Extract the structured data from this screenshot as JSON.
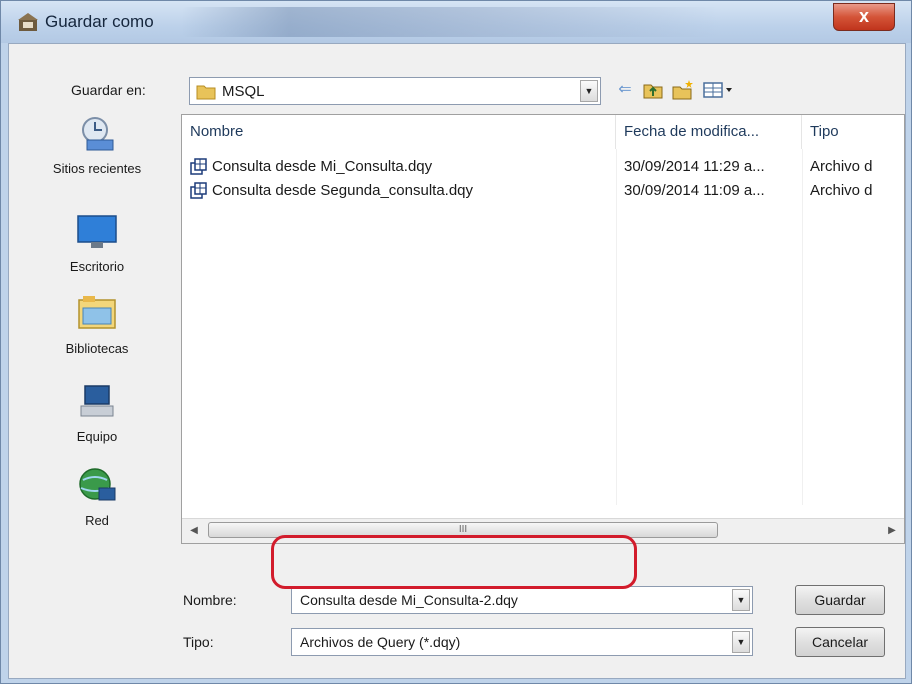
{
  "window": {
    "title": "Guardar como",
    "close_label": "x"
  },
  "toolbar": {
    "save_in_label": "Guardar en:",
    "current_folder": "MSQL",
    "back_icon": "back-arrow-icon",
    "up_icon": "up-folder-icon",
    "new_folder_icon": "new-folder-icon",
    "view_menu_icon": "view-menu-icon"
  },
  "places": [
    {
      "label": "Sitios recientes",
      "icon": "recent-places-icon"
    },
    {
      "label": "Escritorio",
      "icon": "desktop-icon"
    },
    {
      "label": "Bibliotecas",
      "icon": "libraries-icon"
    },
    {
      "label": "Equipo",
      "icon": "computer-icon"
    },
    {
      "label": "Red",
      "icon": "network-icon"
    }
  ],
  "file_list": {
    "columns": [
      "Nombre",
      "Fecha de modifica...",
      "Tipo"
    ],
    "rows": [
      {
        "name": "Consulta desde Mi_Consulta.dqy",
        "date": "30/09/2014 11:29 a...",
        "type": "Archivo d"
      },
      {
        "name": "Consulta desde Segunda_consulta.dqy",
        "date": "30/09/2014 11:09 a...",
        "type": "Archivo d"
      }
    ],
    "scroll_grip": "III"
  },
  "filename": {
    "label": "Nombre:",
    "value": "Consulta desde Mi_Consulta-2.dqy"
  },
  "filetype": {
    "label": "Tipo:",
    "value": "Archivos de Query (*.dqy)"
  },
  "buttons": {
    "save": "Guardar",
    "cancel": "Cancelar"
  },
  "colors": {
    "highlight_ring": "#d21c2c",
    "titlebar": "#bcd1ea",
    "close_button": "#c0341c"
  }
}
